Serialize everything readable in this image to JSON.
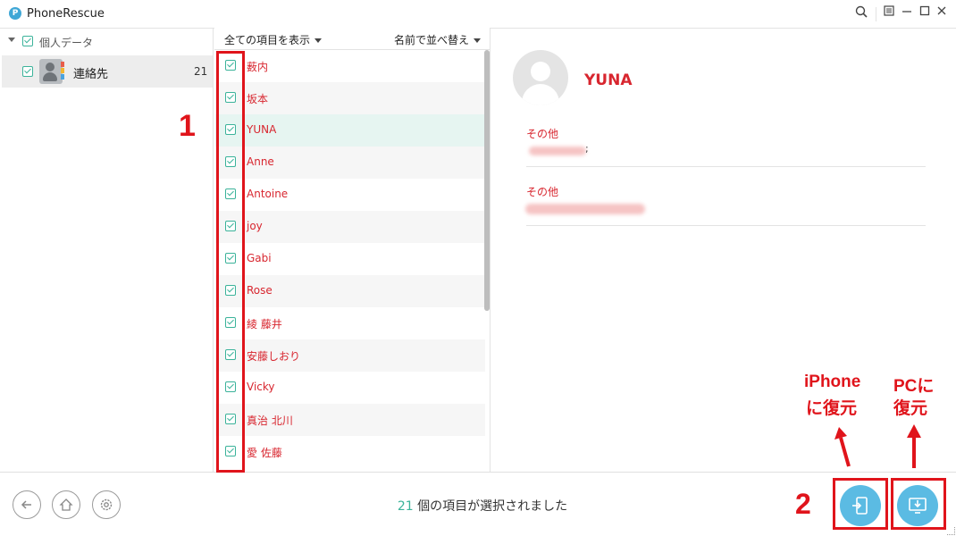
{
  "window": {
    "app_title": "PhoneRescue",
    "logo_letter": "P",
    "controls": [
      "search-icon",
      "menu-icon",
      "minimize-icon",
      "maximize-icon",
      "close-icon"
    ]
  },
  "sidebar": {
    "root_label": "個人データ",
    "category": {
      "label": "連絡先",
      "count": "21"
    }
  },
  "list_header": {
    "filter_label": "全ての項目を表示",
    "sort_label": "名前で並べ替え"
  },
  "contacts": [
    {
      "name": "薮内"
    },
    {
      "name": "坂本"
    },
    {
      "name": "YUNA"
    },
    {
      "name": "Anne"
    },
    {
      "name": "Antoine"
    },
    {
      "name": "joy"
    },
    {
      "name": "Gabi"
    },
    {
      "name": "Rose"
    },
    {
      "name": "綾  藤井"
    },
    {
      "name": "安藤しおり"
    },
    {
      "name": "Vicky"
    },
    {
      "name": "真治  北川"
    },
    {
      "name": "愛  佐藤"
    }
  ],
  "detail": {
    "name": "YUNA",
    "field1_label": "その他",
    "field1_value_suffix": ";",
    "field2_label": "その他"
  },
  "footer": {
    "selected_count": "21",
    "selected_text": " 個の項目が選択されました"
  },
  "annotations": {
    "label_1": "1",
    "label_2": "2",
    "iphone_line1": "iPhone",
    "iphone_line2": "に復元",
    "pc_line1": "PCに",
    "pc_line2": "復元"
  },
  "colors": {
    "accent": "#3bb39a",
    "contact_text": "#d8262f",
    "annotation_red": "#e0141b",
    "restore_button": "#5bbbe3"
  }
}
